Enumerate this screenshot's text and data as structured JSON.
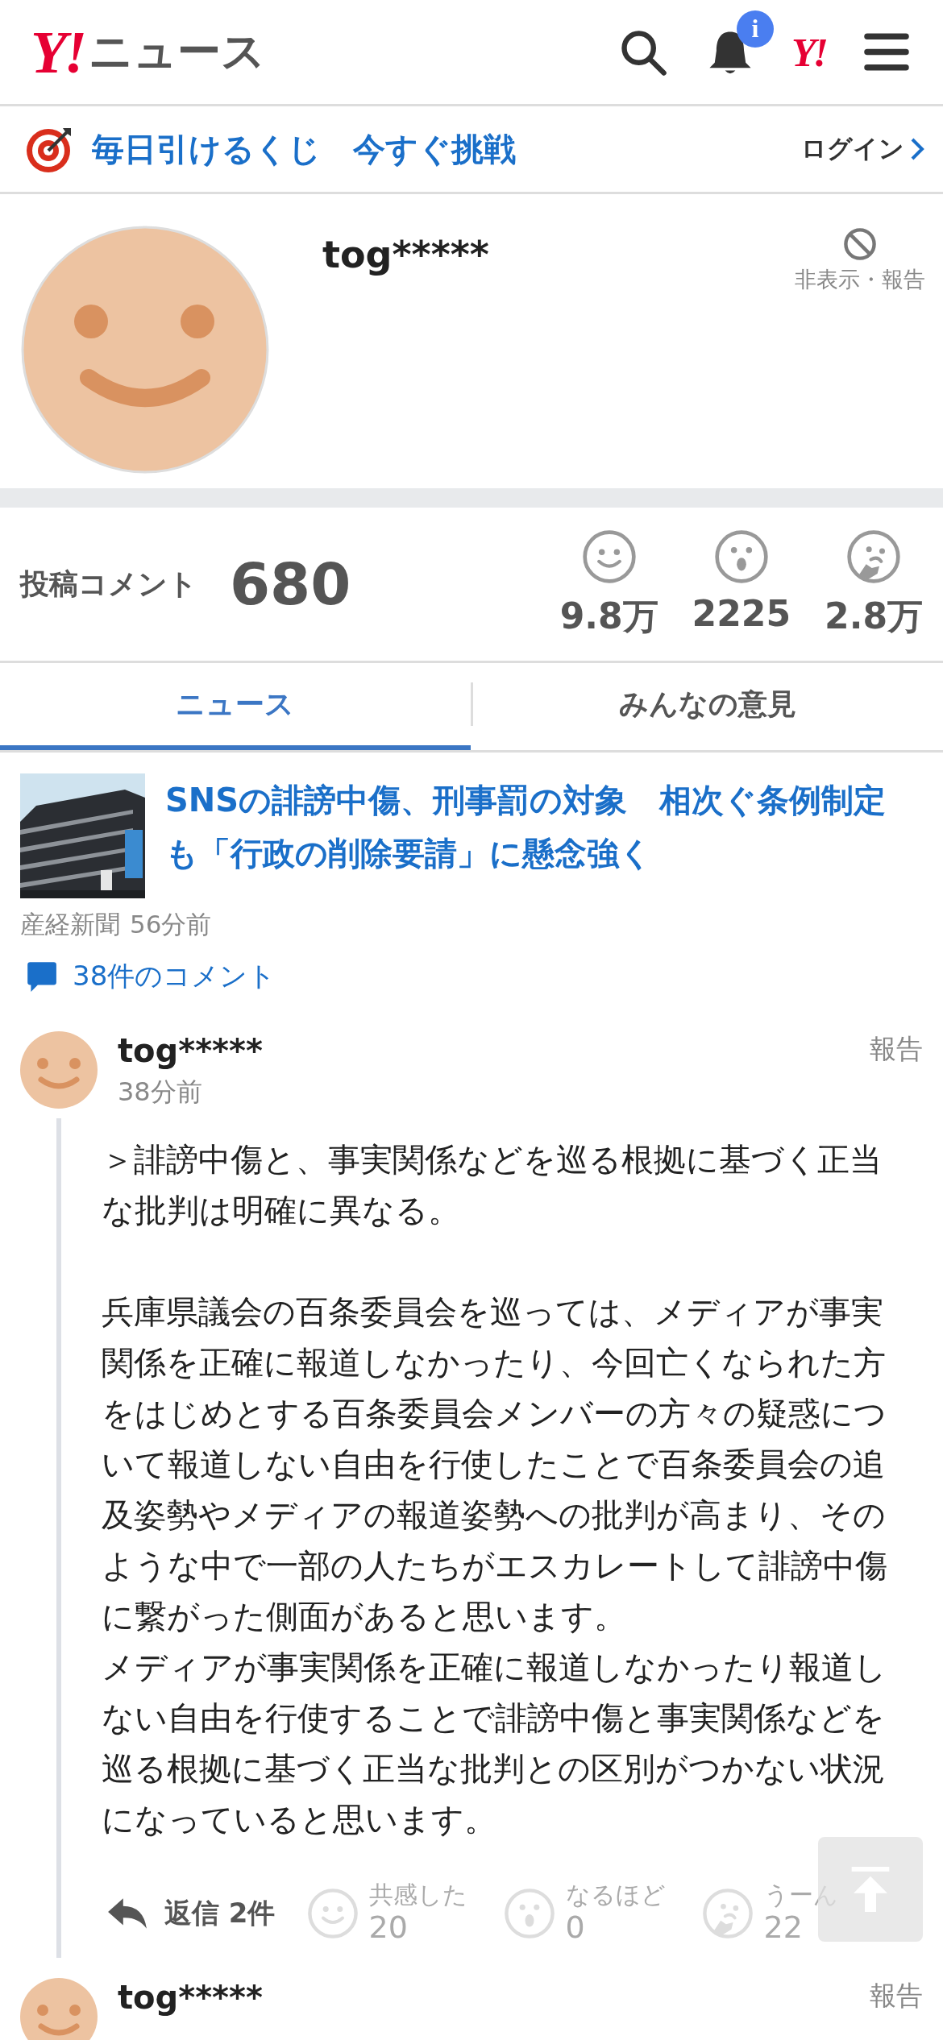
{
  "header": {
    "logo_mark": "Y!",
    "logo_text": "ニュース",
    "notification_badge": "i",
    "account_mark": "Y!"
  },
  "banner": {
    "text": "毎日引けるくじ　今すぐ挑戦",
    "login": "ログイン"
  },
  "profile": {
    "name": "tog*****",
    "hide_report": "非表示・報告"
  },
  "stats": {
    "label": "投稿コメント",
    "count": "680",
    "reactions": [
      {
        "kind": "empathy",
        "count": "9.8万"
      },
      {
        "kind": "surprise",
        "count": "2225"
      },
      {
        "kind": "hmm",
        "count": "2.8万"
      }
    ]
  },
  "tabs": [
    {
      "label": "ニュース",
      "selected": true
    },
    {
      "label": "みんなの意見",
      "selected": false
    }
  ],
  "article": {
    "title": "SNSの誹謗中傷、刑事罰の対象　相次ぐ条例制定も「行政の削除要請」に懸念強く",
    "source": "産経新聞",
    "time": "56分前",
    "comments_link": "38件のコメント"
  },
  "comments": [
    {
      "name": "tog*****",
      "time": "38分前",
      "report": "報告",
      "blocks": [
        [
          "＞誹謗中傷と、事実関係などを巡る根拠に基づく正当な批判は明確に異なる。"
        ],
        [
          "兵庫県議会の百条委員会を巡っては、メディアが事実関係を正確に報道しなかったり、今回亡くなられた方をはじめとする百条委員会メンバーの方々の疑惑について報道しない自由を行使したことで百条委員会の追及姿勢やメディアの報道姿勢への批判が高まり、そのような中で一部の人たちがエスカレートして誹謗中傷に繋がった側面があると思います。",
          "メディアが事実関係を正確に報道しなかったり報道しない自由を行使することで誹謗中傷と事実関係などを巡る根拠に基づく正当な批判との区別がつかない状況になっていると思います。"
        ]
      ],
      "reply": "返信 2件",
      "reactions": [
        {
          "kind": "empathy",
          "label": "共感した",
          "count": "20"
        },
        {
          "kind": "surprise",
          "label": "なるほど",
          "count": "0"
        },
        {
          "kind": "hmm",
          "label": "うーん",
          "count": "22"
        }
      ]
    },
    {
      "name": "tog*****",
      "report": "報告"
    }
  ]
}
